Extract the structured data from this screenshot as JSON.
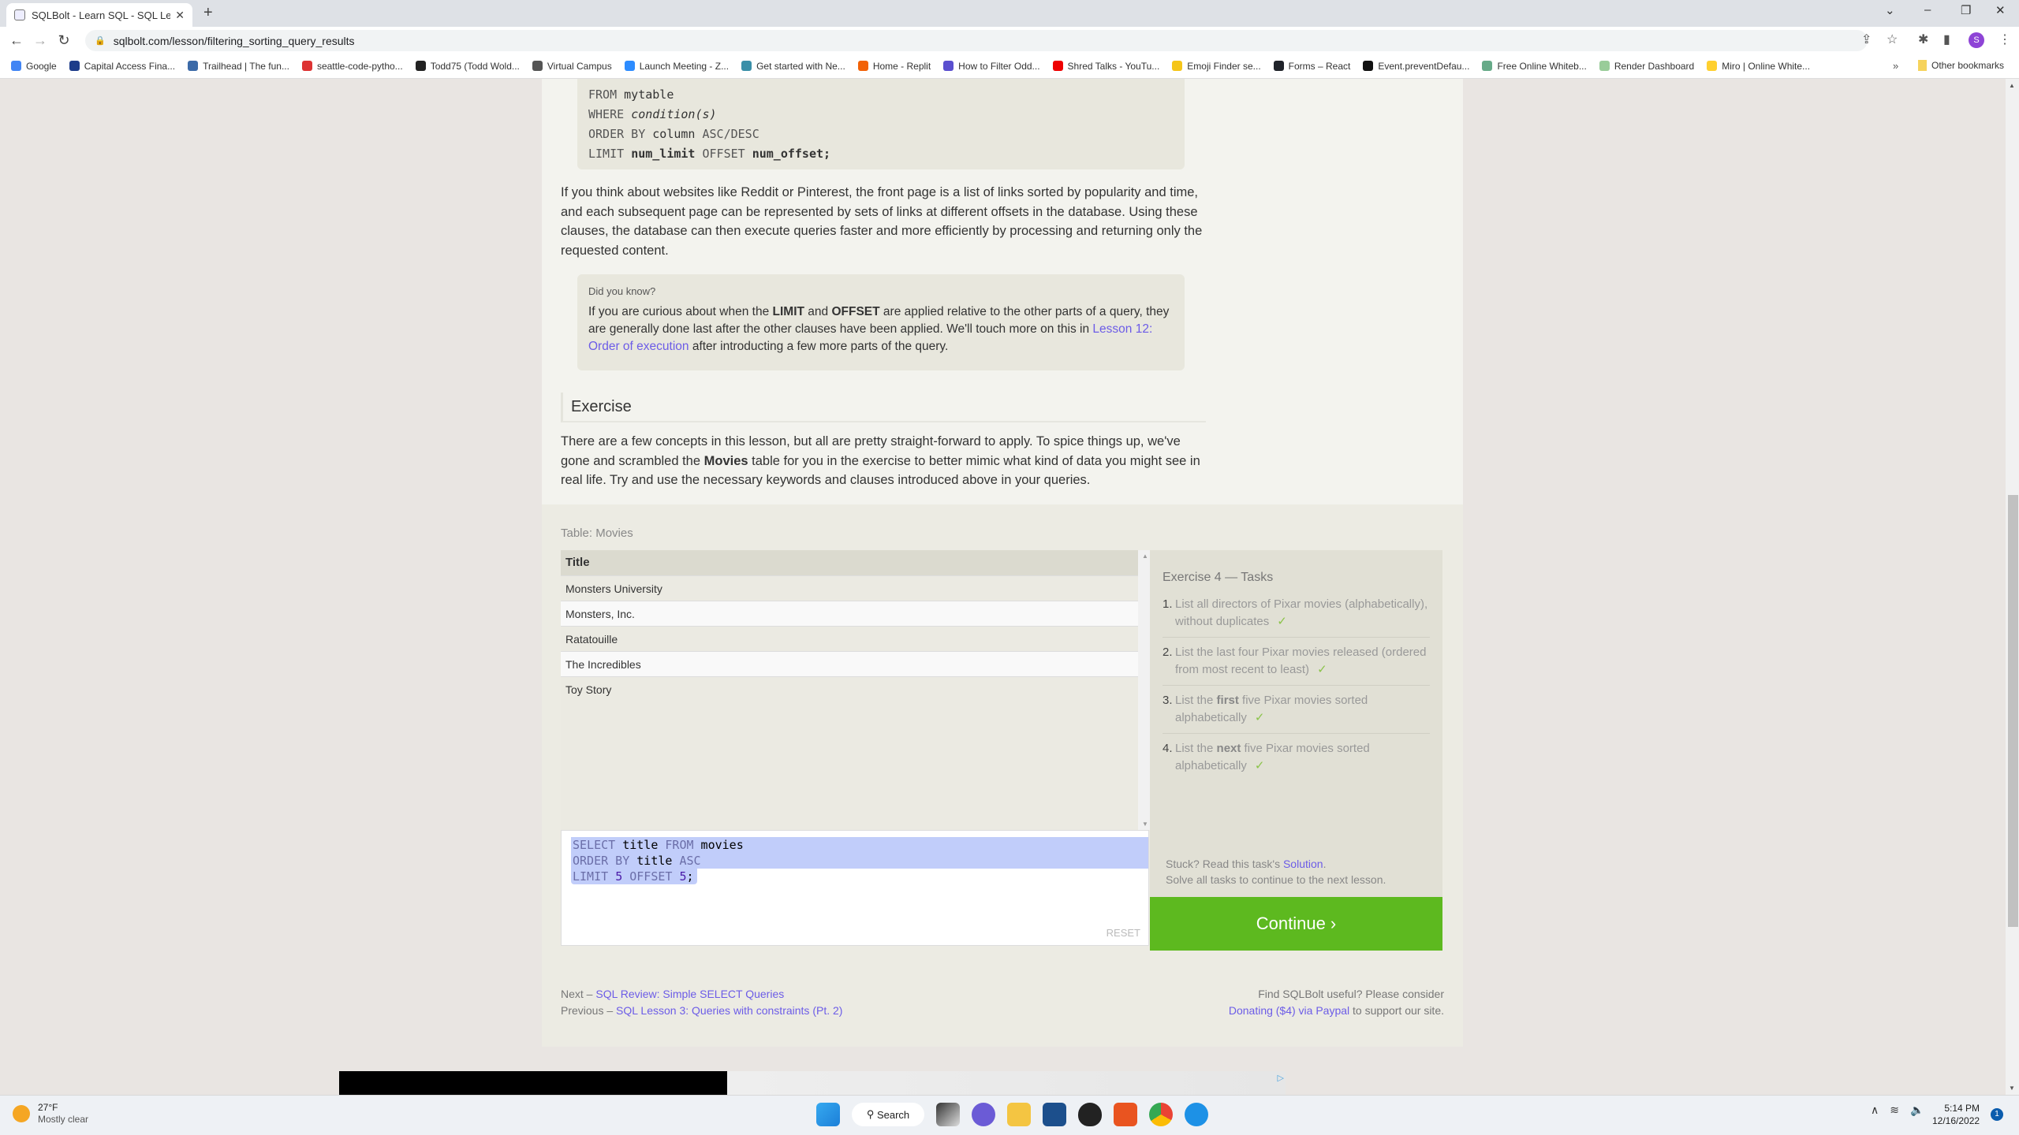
{
  "browser": {
    "tab_title": "SQLBolt - Learn SQL - SQL Lesson",
    "url": "sqlbolt.com/lesson/filtering_sorting_query_results",
    "profile_initial": "S",
    "bookmarks": [
      {
        "label": "Google",
        "color": "#4285f4"
      },
      {
        "label": "Capital Access Fina...",
        "color": "#1d3c8a"
      },
      {
        "label": "Trailhead | The fun...",
        "color": "#3c6aa8"
      },
      {
        "label": "seattle-code-pytho...",
        "color": "#d33"
      },
      {
        "label": "Todd75 (Todd Wold...",
        "color": "#222"
      },
      {
        "label": "Virtual Campus",
        "color": "#555"
      },
      {
        "label": "Launch Meeting - Z...",
        "color": "#2d8cff"
      },
      {
        "label": "Get started with Ne...",
        "color": "#3a8fa8"
      },
      {
        "label": "Home - Replit",
        "color": "#f26207"
      },
      {
        "label": "How to Filter Odd...",
        "color": "#5a4fcf"
      },
      {
        "label": "Shred Talks - YouTu...",
        "color": "#e00"
      },
      {
        "label": "Emoji Finder se...",
        "color": "#f5c518"
      },
      {
        "label": "Forms – React",
        "color": "#20232a"
      },
      {
        "label": "Event.preventDefau...",
        "color": "#111"
      },
      {
        "label": "Free Online Whiteb...",
        "color": "#6a8"
      },
      {
        "label": "Render Dashboard",
        "color": "#9c9"
      },
      {
        "label": "Miro | Online White...",
        "color": "#ffd02f"
      }
    ],
    "bookmarks_overflow": "»",
    "other_bookmarks": "Other bookmarks"
  },
  "lesson": {
    "syntax_lines": [
      {
        "kw": "FROM",
        "rest": "mytable"
      },
      {
        "kw": "WHERE",
        "rest": "condition(s)"
      },
      {
        "kw": "ORDER BY",
        "rest": "column",
        "tail": "ASC/DESC"
      },
      {
        "kw": "LIMIT",
        "rest": "num_limit",
        "kw2": "OFFSET",
        "rest2": "num_offset;"
      }
    ],
    "paragraph1": "If you think about websites like Reddit or Pinterest, the front page is a list of links sorted by popularity and time, and each subsequent page can be represented by sets of links at different offsets in the database. Using these clauses, the database can then execute queries faster and more efficiently by processing and returning only the requested content.",
    "tip": {
      "heading": "Did you know?",
      "text_a": "If you are curious about when the ",
      "kw_limit": "LIMIT",
      "text_b": " and ",
      "kw_offset": "OFFSET",
      "text_c": " are applied relative to the other parts of a query, they are generally done last after the other clauses have been applied. We'll touch more on this in ",
      "link": "Lesson 12: Order of execution",
      "text_d": " after introducting a few more parts of the query."
    },
    "exercise_heading": "Exercise",
    "paragraph2_a": "There are a few concepts in this lesson, but all are pretty straight-forward to apply. To spice things up, we've gone and scrambled the ",
    "paragraph2_bold": "Movies",
    "paragraph2_b": " table for you in the exercise to better mimic what kind of data you might see in real life. Try and use the necessary keywords and clauses introduced above in your queries."
  },
  "exercise": {
    "table_label": "Table: Movies",
    "columns": [
      "Title"
    ],
    "rows": [
      "Monsters University",
      "Monsters, Inc.",
      "Ratatouille",
      "The Incredibles",
      "Toy Story"
    ],
    "query_lines": [
      [
        {
          "t": "SELECT",
          "c": "kw"
        },
        {
          "t": " title ",
          "c": ""
        },
        {
          "t": "FROM",
          "c": "kw"
        },
        {
          "t": " movies",
          "c": ""
        }
      ],
      [
        {
          "t": "ORDER BY",
          "c": "kw"
        },
        {
          "t": " title ",
          "c": ""
        },
        {
          "t": "ASC",
          "c": "kw"
        }
      ],
      [
        {
          "t": "LIMIT",
          "c": "kw"
        },
        {
          "t": " ",
          "c": ""
        },
        {
          "t": "5",
          "c": "num"
        },
        {
          "t": " ",
          "c": ""
        },
        {
          "t": "OFFSET",
          "c": "kw"
        },
        {
          "t": " ",
          "c": ""
        },
        {
          "t": "5",
          "c": "num"
        },
        {
          "t": ";",
          "c": ""
        }
      ]
    ],
    "reset_label": "RESET",
    "tasks_heading": "Exercise 4 — Tasks",
    "tasks": [
      {
        "num": "1.",
        "pre": "List all directors of Pixar movies (alphabetically), without duplicates",
        "bold": "",
        "post": "",
        "done": true
      },
      {
        "num": "2.",
        "pre": "List the last four Pixar movies released (ordered from most recent to least)",
        "bold": "",
        "post": "",
        "done": true
      },
      {
        "num": "3.",
        "pre": "List the ",
        "bold": "first",
        "post": " five Pixar movies sorted alphabetically",
        "done": true
      },
      {
        "num": "4.",
        "pre": "List the ",
        "bold": "next",
        "post": " five Pixar movies sorted alphabetically",
        "done": true
      }
    ],
    "check_mark": "✓",
    "stuck_text": "Stuck? Read this task's ",
    "solution_link": "Solution",
    "stuck_period": ".",
    "solve_all": "Solve all tasks to continue to the next lesson.",
    "continue_label": "Continue ›",
    "continue_color": "#5db91f"
  },
  "footer": {
    "next_prefix": "Next – ",
    "next_link": "SQL Review: Simple SELECT Queries",
    "prev_prefix": "Previous – ",
    "prev_link": "SQL Lesson 3: Queries with constraints (Pt. 2)",
    "support_line": "Find SQLBolt useful? Please consider",
    "donate_link": "Donating ($4) via Paypal",
    "donate_suffix": " to support our site."
  },
  "taskbar": {
    "temperature": "27°F",
    "weather": "Mostly clear",
    "search_label": "Search",
    "time": "5:14 PM",
    "date": "12/16/2022",
    "notifications": "1"
  }
}
